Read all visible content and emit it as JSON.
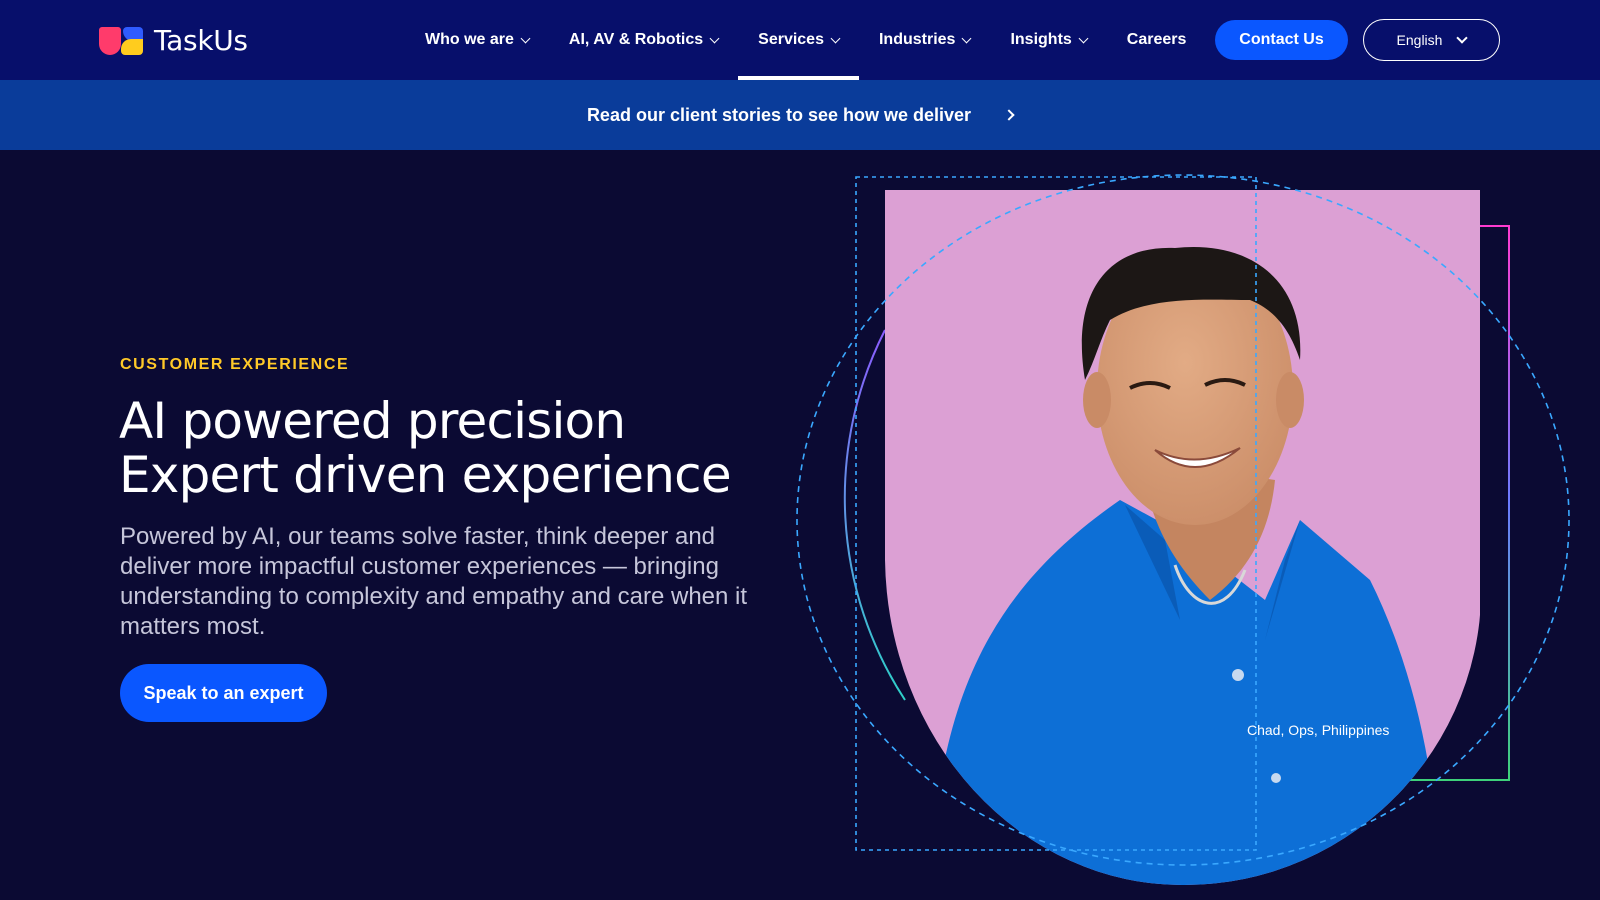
{
  "brand": {
    "name": "TaskUs"
  },
  "nav": {
    "items": [
      {
        "label": "Who we are",
        "has_dropdown": true
      },
      {
        "label": "AI, AV & Robotics",
        "has_dropdown": true
      },
      {
        "label": "Services",
        "has_dropdown": true,
        "active": true
      },
      {
        "label": "Industries",
        "has_dropdown": true
      },
      {
        "label": "Insights",
        "has_dropdown": true
      },
      {
        "label": "Careers",
        "has_dropdown": false
      }
    ],
    "contact_label": "Contact Us",
    "language": "English"
  },
  "banner": {
    "text": "Read our client stories to see how we deliver"
  },
  "hero": {
    "eyebrow": "CUSTOMER EXPERIENCE",
    "headline_line1": "AI powered precision",
    "headline_line2": "Expert driven experience",
    "subtext": "Powered by AI, our teams solve faster, think deeper and deliver more impactful customer experiences — bringing understanding to complexity and empathy and care when it matters most.",
    "cta_label": "Speak to an expert",
    "photo_caption": "Chad, Ops, Philippines"
  },
  "colors": {
    "page_bg": "#0b0a33",
    "nav_bg": "#070f6b",
    "banner_bg": "#0a3c9a",
    "accent_button": "#0a57ff",
    "eyebrow": "#ffc928",
    "photo_bg": "#dca0d4",
    "shirt": "#0d6fd6"
  },
  "icons": [
    "chevron-down-icon",
    "chevron-right-icon"
  ]
}
